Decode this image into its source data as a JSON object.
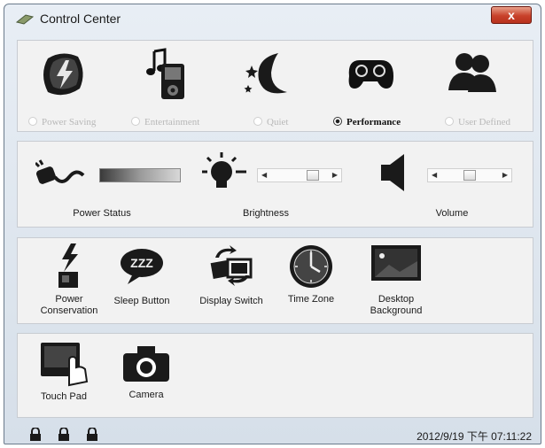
{
  "window": {
    "title": "Control Center",
    "close_label": "x"
  },
  "modes": [
    {
      "label": "Power Saving",
      "selected": false,
      "icon": "battery-lightning-icon"
    },
    {
      "label": "Entertainment",
      "selected": false,
      "icon": "music-player-icon"
    },
    {
      "label": "Quiet",
      "selected": false,
      "icon": "moon-stars-icon"
    },
    {
      "label": "Performance",
      "selected": true,
      "icon": "gamepad-icon"
    },
    {
      "label": "User Defined",
      "selected": false,
      "icon": "users-icon"
    }
  ],
  "controls": {
    "power_status": {
      "label": "Power Status",
      "icon": "power-plug-icon"
    },
    "brightness": {
      "label": "Brightness",
      "icon": "light-bulb-icon",
      "level": 0.78
    },
    "volume": {
      "label": "Volume",
      "icon": "speaker-icon",
      "level": 0.5
    }
  },
  "tools": [
    {
      "label": "Power Conservation",
      "icon": "power-conservation-icon"
    },
    {
      "label": "Sleep Button",
      "icon": "sleep-zzz-icon"
    },
    {
      "label": "Display Switch",
      "icon": "display-switch-icon"
    },
    {
      "label": "Time Zone",
      "icon": "clock-icon"
    },
    {
      "label": "Desktop Background",
      "icon": "desktop-background-icon"
    }
  ],
  "devices": [
    {
      "label": "Touch Pad",
      "icon": "touchpad-icon"
    },
    {
      "label": "Camera",
      "icon": "camera-icon"
    }
  ],
  "statusbar": {
    "locks": [
      "caps-lock-icon",
      "num-lock-icon",
      "scroll-lock-icon"
    ],
    "datetime": "2012/9/19 下午 07:11:22"
  }
}
